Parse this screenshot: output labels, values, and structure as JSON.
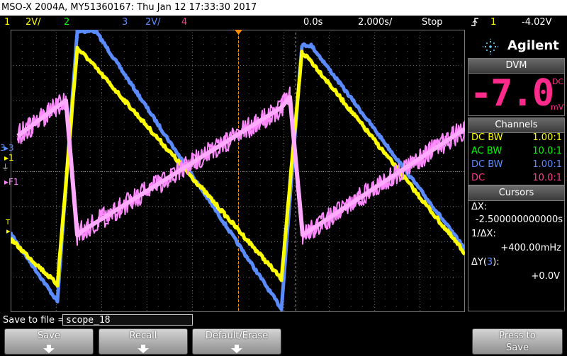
{
  "title_bar": "MSO-X 2004A, MY51360167: Thu Jan 12 17:33:30 2017",
  "status": {
    "ch1_num": "1",
    "ch1_scale": "2V/",
    "ch2_num": "2",
    "ch3_num": "3",
    "ch3_scale": "2V/",
    "ch4_num": "4",
    "time_delay": "0.0s",
    "time_scale": "2.000s/",
    "run_state": "Stop",
    "trig_source": "1",
    "trig_level": "-4.02V"
  },
  "markers": {
    "ch3": "3",
    "ch1": "1",
    "f1": "F1",
    "trig": "T"
  },
  "panel": {
    "brand": "Agilent",
    "dvm_header": "DVM",
    "dvm_value": "-7.01",
    "dvm_mode": "DC",
    "dvm_unit": "mV",
    "channels_header": "Channels",
    "channels": [
      {
        "coupling": "DC BW",
        "ratio": "1.00:1",
        "color": "#ffff00"
      },
      {
        "coupling": "AC BW",
        "ratio": "10.0:1",
        "color": "#00ff00"
      },
      {
        "coupling": "DC BW",
        "ratio": "1.00:1",
        "color": "#5a8cff"
      },
      {
        "coupling": "DC",
        "ratio": "10.0:1",
        "color": "#ff3c8c"
      }
    ],
    "cursors_header": "Cursors",
    "dx_label": "ΔX:",
    "dx_value": "-2.500000000000s",
    "inv_dx_label": "1/ΔX:",
    "inv_dx_value": "+400.00mHz",
    "dy_label_pre": "ΔY(",
    "dy_label_ch": "3",
    "dy_label_post": "):",
    "dy_value": "+0.0V"
  },
  "save": {
    "label": "Save to file =",
    "filename": "scope_18"
  },
  "softkeys": {
    "save": "Save",
    "recall": "Recall",
    "default_erase": "Default/Erase",
    "press_to_save_1": "Press to",
    "press_to_save_2": "Save"
  },
  "colors": {
    "ch1": "#ffff00",
    "ch2": "#00ff00",
    "ch3": "#5a8cff",
    "ch4": "#ff3c8c",
    "math": "#ff88ff",
    "cursor": "#ff8c00"
  }
}
